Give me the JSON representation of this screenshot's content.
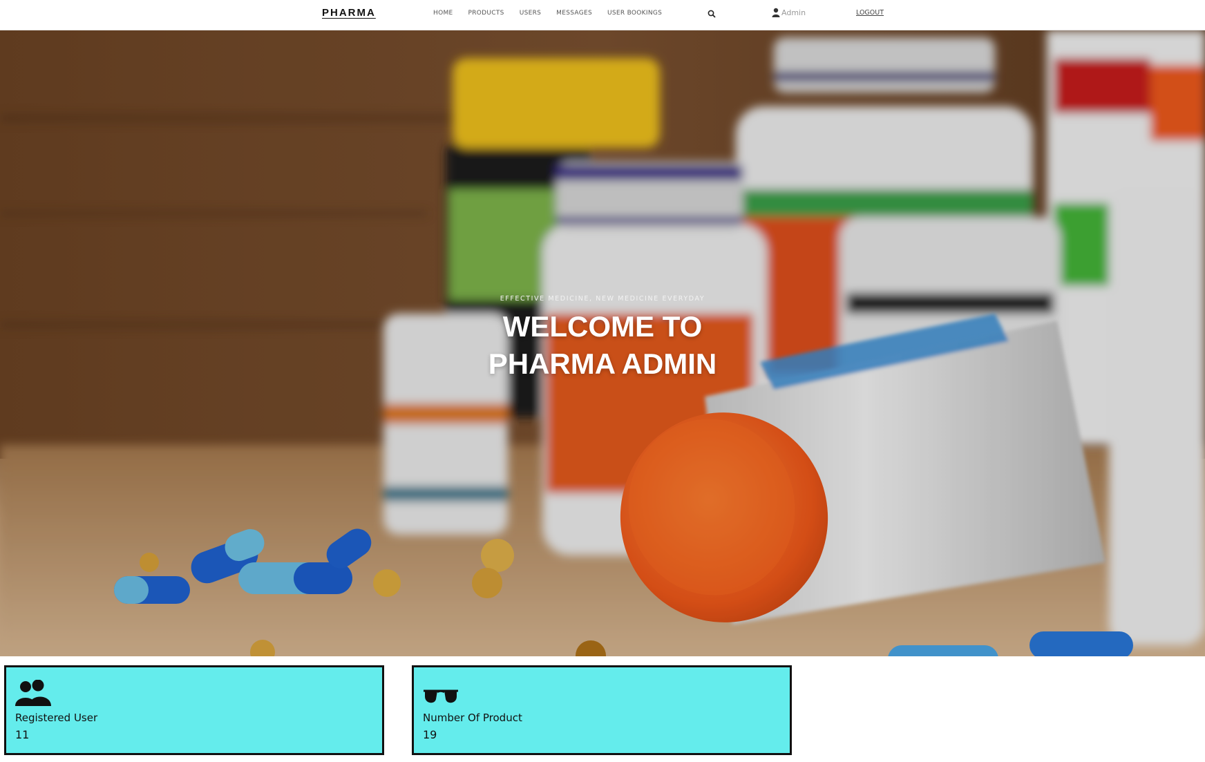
{
  "header": {
    "brand": "PHARMA",
    "nav": [
      {
        "label": "HOME"
      },
      {
        "label": "PRODUCTS"
      },
      {
        "label": "USERS"
      },
      {
        "label": "MESSAGES"
      },
      {
        "label": "USER BOOKINGS"
      }
    ],
    "search_icon": "search-icon",
    "user": {
      "icon": "user-icon",
      "name": "Admin"
    },
    "logout": "LOGOUT"
  },
  "hero": {
    "kicker": "EFFECTIVE MEDICINE, NEW MEDICINE EVERYDAY",
    "title_line1": "WELCOME TO",
    "title_line2": "PHARMA ADMIN"
  },
  "stats": [
    {
      "icon": "users-icon",
      "label": "Registered User",
      "value": "11"
    },
    {
      "icon": "glasses-icon",
      "label": "Number Of Product",
      "value": "19"
    }
  ],
  "colors": {
    "card_bg": "#64ecec",
    "card_border": "#111111",
    "hero_text": "#ffffff"
  }
}
